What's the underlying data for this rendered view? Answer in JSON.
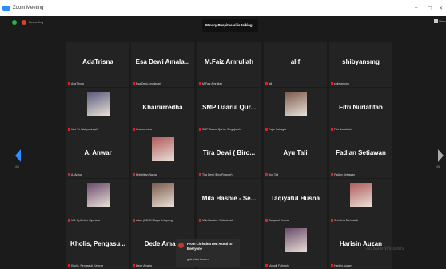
{
  "window": {
    "title": "Zoom Meeting",
    "minimize": "–",
    "maximize": "▢",
    "close": "✕"
  },
  "topbar": {
    "recording": "Recording",
    "view": "View",
    "talking": "Windry Puspitasari is talking..."
  },
  "paging": {
    "left": "4/6",
    "right": "4/6"
  },
  "tiles": [
    {
      "name": "AdaTrisna",
      "label": "AdaTrisna"
    },
    {
      "name": "Esa Dewi Amala...",
      "label": "Esa Dewi Amalasari"
    },
    {
      "name": "M.Faiz Amrullah",
      "label": "M.Faiz Amrullah"
    },
    {
      "name": "alif",
      "label": "alif"
    },
    {
      "name": "shibyansmg",
      "label": "shibyansmg"
    },
    {
      "name": "",
      "label": "Umi Tri Wahyuningsih",
      "photo": true
    },
    {
      "name": "Khairurredha",
      "label": "Khairurredha"
    },
    {
      "name": "SMP Daarul Qur...",
      "label": "SMP Daarul Qur'an Singojuruh"
    },
    {
      "name": "",
      "label": "Fajar Subagia",
      "photo": true
    },
    {
      "name": "Fitri Nurlatifah",
      "label": "Fitri Nurlatifah"
    },
    {
      "name": "A. Anwar",
      "label": "A. Anwar"
    },
    {
      "name": "",
      "label": "Dhistrikan Nasra",
      "photo": true
    },
    {
      "name": "Tira Dewi ( Biro...",
      "label": "Tira Dewi (Biro Finance)"
    },
    {
      "name": "Ayu Tali",
      "label": "Ayu Tali"
    },
    {
      "name": "Fadlan Setiawan",
      "label": "Fadlan Setiawan"
    },
    {
      "name": "",
      "label": "161 Syifa Ayu Syuhada",
      "photo": true
    },
    {
      "name": "",
      "label": "Adah (KB-TK Daqu Ketapang)",
      "photo": true
    },
    {
      "name": "Mila Hasbie - Se...",
      "label": "Mila Hasbie - Sekretariat"
    },
    {
      "name": "Taqiyatul Husna",
      "label": "Taqiyatul Husna"
    },
    {
      "name": "",
      "label": "Christina Dwi Astuti",
      "photo": true
    },
    {
      "name": "Kholis, Pengasu...",
      "label": "Kholis, Pengasuh Kayung"
    },
    {
      "name": "Dede Ama...",
      "label": "Dede Amalia"
    },
    {
      "name": "...a...",
      "label": ""
    },
    {
      "name": "",
      "label": "Muhalli Fatimah",
      "photo": true
    },
    {
      "name": "Harisin Auzan",
      "label": "Harisin Auzan"
    }
  ],
  "chat": {
    "from": "From Christina Dwi Astuti to Everyone",
    "message": "gak bisa incam"
  },
  "watermark": "Activate Windows",
  "colors": {
    "bg": "#1b1b1b",
    "tile": "#232323",
    "accent": "#2d8cff",
    "rec": "#d9432e"
  }
}
